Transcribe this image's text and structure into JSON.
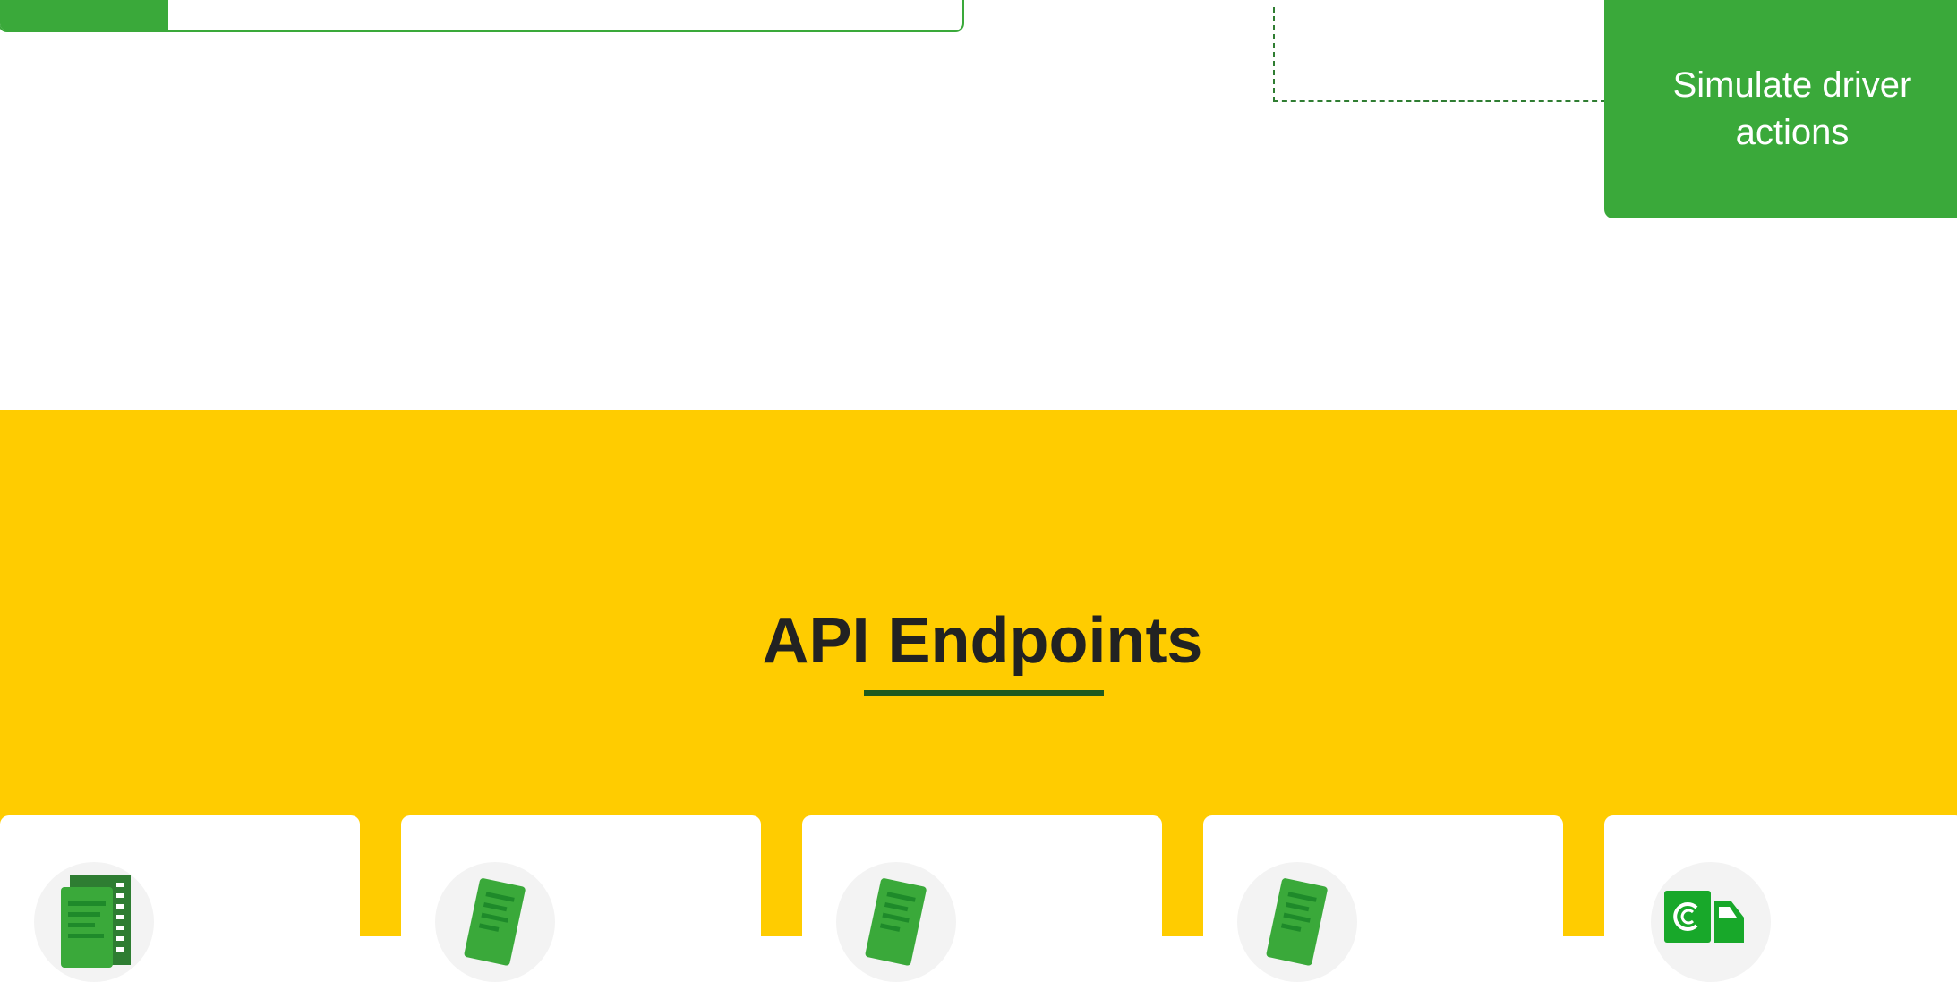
{
  "simulate_card": {
    "label": "Simulate driver actions"
  },
  "api_section": {
    "title": "API Endpoints"
  },
  "endpoint_cards": [
    {
      "icon": "documents-stack-icon"
    },
    {
      "icon": "document-icon"
    },
    {
      "icon": "document-icon"
    },
    {
      "icon": "document-icon"
    },
    {
      "icon": "delivery-truck-icon"
    }
  ],
  "colors": {
    "brand_green": "#3aa93a",
    "dark_green": "#1e5a1e",
    "section_yellow": "#ffcc00",
    "title_text": "#222222"
  }
}
